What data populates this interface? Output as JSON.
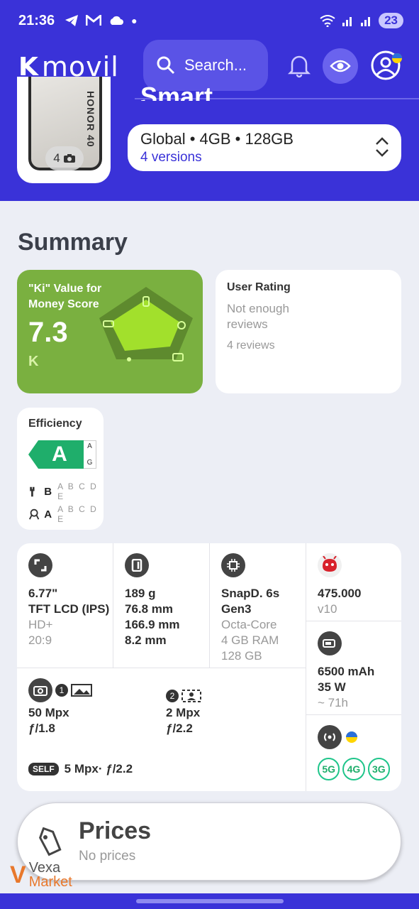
{
  "status_bar": {
    "time": "21:36",
    "battery": "23"
  },
  "header": {
    "logo_ki": "K",
    "logo_text": "movil",
    "search_placeholder": "Search...",
    "title_fragment": "Smart",
    "photo_count": "4",
    "phone_brand": "HONOR 40",
    "version": {
      "region": "Global",
      "ram": "4GB",
      "storage": "128GB",
      "line": "Global  •  4GB  •  128GB",
      "count": "4 versions"
    }
  },
  "summary": {
    "title": "Summary",
    "value_score": {
      "label": "\"Ki\" Value for Money Score",
      "value": "7.3",
      "mark": "K"
    },
    "user_rating": {
      "title": "User Rating",
      "status": "Not enough reviews",
      "count": "4 reviews"
    },
    "efficiency": {
      "title": "Efficiency",
      "grade": "A",
      "scale_top": "A",
      "scale_bottom": "G",
      "repair": {
        "selected": "B",
        "letters": "A B C D E"
      },
      "durability": {
        "selected": "A",
        "letters": "A B C D E"
      }
    }
  },
  "specs": {
    "display": {
      "size": "6.77\"",
      "type": "TFT LCD (IPS)",
      "resolution": "HD+",
      "ratio": "20:9"
    },
    "body": {
      "weight": "189 g",
      "w": "76.8 mm",
      "h": "166.9 mm",
      "d": "8.2 mm"
    },
    "cpu": {
      "chip": "SnapD. 6s Gen3",
      "cores": "Octa-Core",
      "ram": "4 GB RAM",
      "storage": "128 GB"
    },
    "antutu": {
      "score": "475.000",
      "version": "v10"
    },
    "battery": {
      "capacity": "6500 mAh",
      "charge": "35 W",
      "duration": "~ 71h"
    },
    "camera": {
      "main": {
        "n": "1",
        "mp": "50 Mpx",
        "f": "ƒ/1.8"
      },
      "second": {
        "n": "2",
        "mp": "2 Mpx",
        "f": "ƒ/2.2"
      },
      "selfie_tag": "SELF",
      "selfie": "5 Mpx· ƒ/2.2"
    },
    "network": [
      "5G",
      "4G",
      "3G"
    ]
  },
  "prices": {
    "title": "Prices",
    "status": "No prices"
  },
  "watermark": {
    "line1": "Vexa",
    "line2": "Market"
  },
  "colors": {
    "primary": "#3a32d8",
    "score_green": "#7ab040",
    "grade_green": "#1fae6b"
  }
}
